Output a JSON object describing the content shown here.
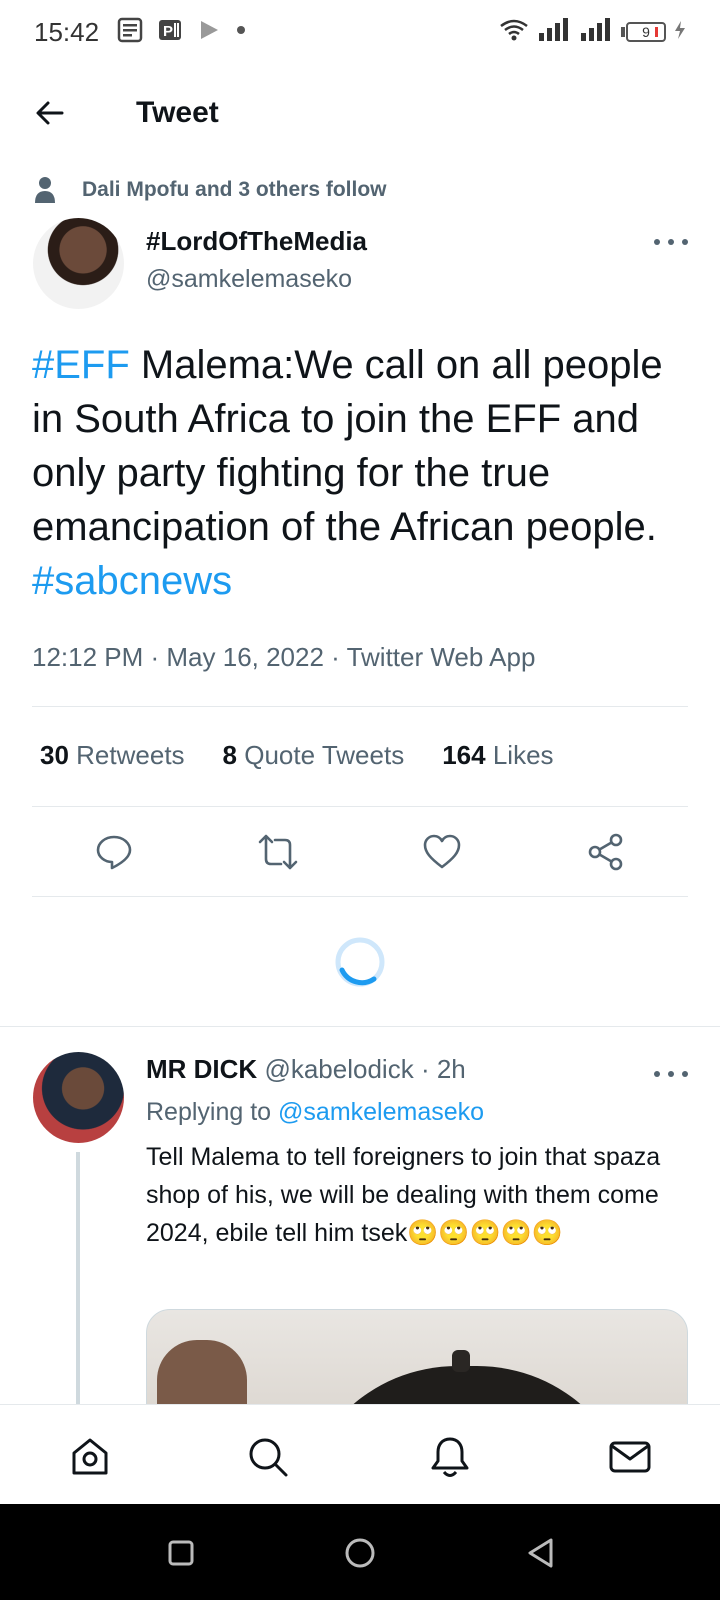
{
  "status_bar": {
    "time": "15:42",
    "battery": "9",
    "icons": [
      "news-icon",
      "parking-icon",
      "play-icon",
      "dot-icon",
      "wifi-icon",
      "signal-icon",
      "signal-icon",
      "battery-icon",
      "charging-icon"
    ]
  },
  "header": {
    "title": "Tweet",
    "back_icon": "arrow-left-icon"
  },
  "tweet": {
    "social_context": "Dali Mpofu and 3 others follow",
    "author_name": "#LordOfTheMedia",
    "author_handle": "@samkelemaseko",
    "text_parts": [
      {
        "text": "#EFF",
        "hashtag": true
      },
      {
        "text": " Malema:We call on all people in South Africa to join the EFF and only party fighting for the true emancipation of the African people. ",
        "hashtag": false
      },
      {
        "text": "#sabcnews",
        "hashtag": true
      }
    ],
    "meta": "12:12 PM · May 16, 2022 · Twitter Web App",
    "stats": {
      "retweets_count": "30",
      "retweets_label": "Retweets",
      "quotes_count": "8",
      "quotes_label": "Quote Tweets",
      "likes_count": "164",
      "likes_label": "Likes"
    },
    "actions": [
      "reply-icon",
      "retweet-icon",
      "like-icon",
      "share-icon"
    ]
  },
  "reply": {
    "name": "MR DICK",
    "handle": "@kabelodick",
    "time": "· 2h",
    "replying_label": "Replying to",
    "replying_to": "@samkelemaseko",
    "text": "Tell Malema to tell foreigners to join that spaza shop of his, we will be dealing with them come 2024, ebile tell him tsek🙄🙄🙄🙄🙄"
  },
  "bottom_nav": [
    "home-icon",
    "search-icon",
    "notifications-icon",
    "messages-icon"
  ],
  "system_nav": [
    "recents-icon",
    "home-circle-icon",
    "back-triangle-icon"
  ],
  "colors": {
    "accent": "#1d9bf0",
    "text": "#0f1419",
    "secondary": "#536471",
    "divider": "#e5e9ec"
  }
}
